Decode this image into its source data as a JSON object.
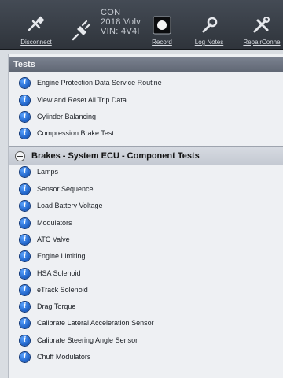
{
  "toolbar": {
    "disconnect_label": "Disconnect",
    "record_label": "Record",
    "log_notes_label": "Log Notes",
    "repair_label": "RepairConne",
    "vehicle_line1": "CON",
    "vehicle_line2": "2018 Volv",
    "vehicle_line3": "VIN: 4V4I"
  },
  "tests_panel": {
    "header": "Tests",
    "items": [
      {
        "label": "Engine Protection Data Service Routine"
      },
      {
        "label": "View and Reset All Trip Data"
      },
      {
        "label": "Cylinder Balancing"
      },
      {
        "label": "Compression Brake Test"
      }
    ]
  },
  "brakes_section": {
    "title": "Brakes - System ECU - Component Tests",
    "items": [
      {
        "label": "Lamps"
      },
      {
        "label": "Sensor Sequence"
      },
      {
        "label": "Load Battery Voltage"
      },
      {
        "label": "Modulators"
      },
      {
        "label": "ATC Valve"
      },
      {
        "label": "Engine Limiting"
      },
      {
        "label": "HSA Solenoid"
      },
      {
        "label": "eTrack Solenoid"
      },
      {
        "label": "Drag Torque"
      },
      {
        "label": "Calibrate Lateral Acceleration Sensor"
      },
      {
        "label": "Calibrate Steering Angle Sensor"
      },
      {
        "label": "Chuff Modulators"
      }
    ]
  },
  "icons": {
    "info": "i"
  }
}
